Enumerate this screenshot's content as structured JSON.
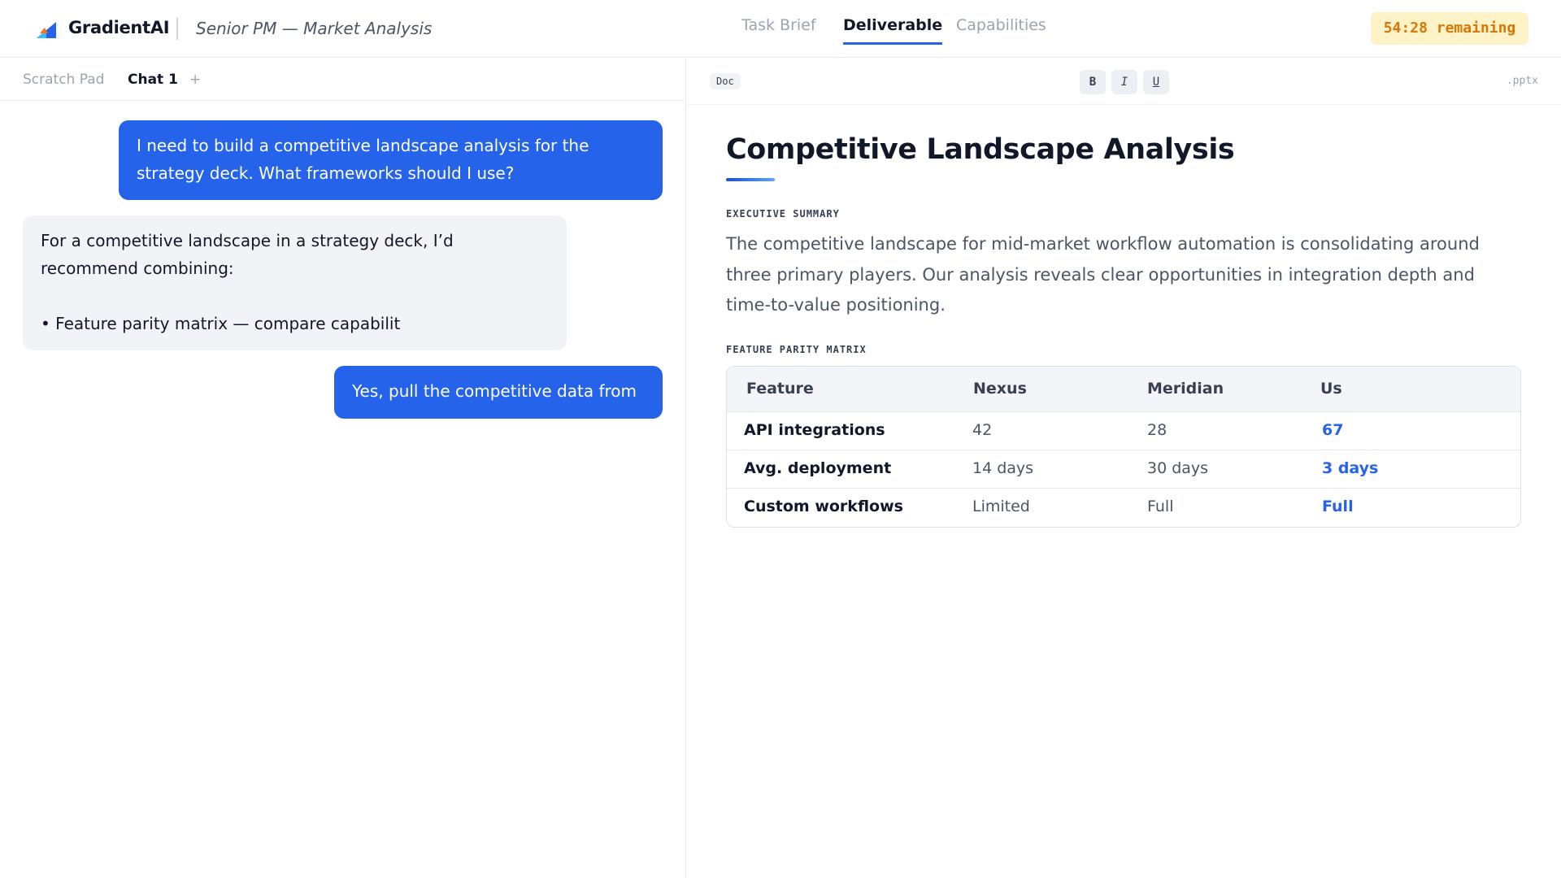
{
  "header": {
    "brand": "GradientAI",
    "subtitle": "Senior PM — Market Analysis",
    "nav": [
      "Task Brief",
      "Deliverable",
      "Capabilities"
    ],
    "active_nav": "Deliverable",
    "timer": "54:28 remaining",
    "accent_color": "#2563eb",
    "logo_icon": "gradient-logo-icon"
  },
  "left_panel": {
    "tabs": [
      "Scratch Pad",
      "Chat 1",
      "+"
    ],
    "active_tab": "Chat 1",
    "messages": [
      {
        "role": "user",
        "lines": [
          "I need to build a competitive landscape analysis for the",
          "strategy deck. What frameworks should I use?"
        ]
      },
      {
        "role": "assistant",
        "lines": [
          "For a competitive landscape in a strategy deck, I’d",
          "recommend combining:",
          "",
          "• Feature parity matrix — compare capabilit"
        ]
      },
      {
        "role": "user",
        "lines": [
          "Yes, pull the competitive data from"
        ]
      }
    ]
  },
  "right_panel": {
    "toolbar": {
      "doc_label": "Doc",
      "bold": "B",
      "italic": "I",
      "underline": "U",
      "extension": ".pptx"
    },
    "doc": {
      "title": "Competitive Landscape Analysis",
      "summary_label": "EXECUTIVE SUMMARY",
      "summary_lines": [
        "The competitive landscape for mid-market workflow automation is consolidating around",
        "three primary players. Our analysis reveals clear opportunities in integration depth and",
        "time-to-value positioning."
      ],
      "matrix_label": "FEATURE PARITY MATRIX",
      "table": {
        "headers": [
          "Feature",
          "Nexus",
          "Meridian",
          "Us"
        ],
        "rows": [
          [
            "API integrations",
            "42",
            "28",
            "67"
          ],
          [
            "Avg. deployment",
            "14 days",
            "30 days",
            "3 days"
          ],
          [
            "Custom workflows",
            "Limited",
            "Full",
            "Full"
          ]
        ]
      }
    }
  }
}
